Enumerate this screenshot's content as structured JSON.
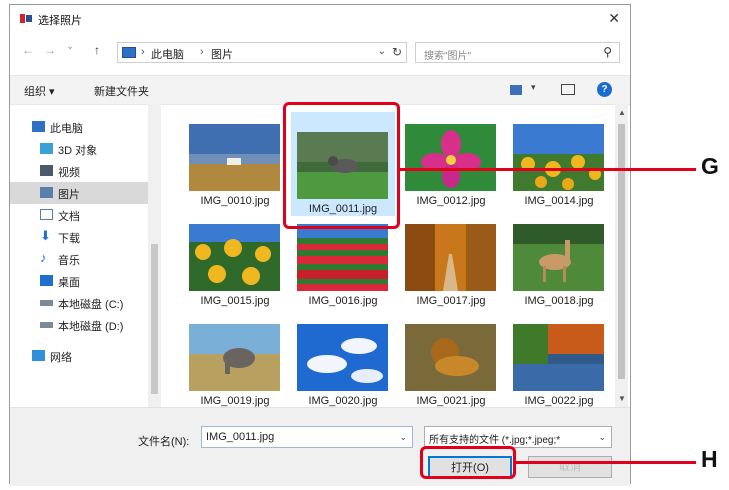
{
  "dialog": {
    "title": "选择照片",
    "close_glyph": "✕"
  },
  "address": {
    "back_glyph": "←",
    "forward_glyph": "→",
    "recent_glyph": "⌄",
    "up_glyph": "↑",
    "segments": [
      "此电脑",
      "图片"
    ],
    "separator": "›",
    "dropdown_glyph": "⌄",
    "refresh_glyph": "↻"
  },
  "search": {
    "placeholder": "搜索\"图片\"",
    "icon_glyph": "⚲"
  },
  "toolbar": {
    "organize_label": "组织 ▾",
    "new_folder_label": "新建文件夹",
    "view_dropdown_glyph": "▾",
    "help_label": "?"
  },
  "sidebar": {
    "items": [
      {
        "label": "此电脑",
        "icon": "computer-icon"
      },
      {
        "label": "3D 对象",
        "icon": "3d-objects-icon"
      },
      {
        "label": "视频",
        "icon": "video-icon"
      },
      {
        "label": "图片",
        "icon": "pictures-icon"
      },
      {
        "label": "文档",
        "icon": "documents-icon"
      },
      {
        "label": "下载",
        "icon": "download-icon"
      },
      {
        "label": "音乐",
        "icon": "music-icon"
      },
      {
        "label": "桌面",
        "icon": "desktop-icon"
      },
      {
        "label": "本地磁盘 (C:)",
        "icon": "drive-icon"
      },
      {
        "label": "本地磁盘 (D:)",
        "icon": "drive-icon"
      },
      {
        "label": "网络",
        "icon": "network-icon"
      }
    ],
    "selected": "图片"
  },
  "files": [
    {
      "name": "IMG_0010.jpg",
      "scene": "horse"
    },
    {
      "name": "IMG_0011.jpg",
      "scene": "cat",
      "selected": true
    },
    {
      "name": "IMG_0012.jpg",
      "scene": "flower"
    },
    {
      "name": "IMG_0014.jpg",
      "scene": "sunflowers"
    },
    {
      "name": "IMG_0015.jpg",
      "scene": "sunflowers"
    },
    {
      "name": "IMG_0016.jpg",
      "scene": "tulips"
    },
    {
      "name": "IMG_0017.jpg",
      "scene": "autumn-road"
    },
    {
      "name": "IMG_0018.jpg",
      "scene": "deer"
    },
    {
      "name": "IMG_0019.jpg",
      "scene": "elephant"
    },
    {
      "name": "IMG_0020.jpg",
      "scene": "clouds"
    },
    {
      "name": "IMG_0021.jpg",
      "scene": "lion"
    },
    {
      "name": "IMG_0022.jpg",
      "scene": "lake"
    }
  ],
  "footer": {
    "filename_label": "文件名(N):",
    "filename_value": "IMG_0011.jpg",
    "filter_value": "所有支持的文件 (*.jpg;*.jpeg;*",
    "dropdown_glyph": "⌄",
    "open_label": "打开(O)",
    "cancel_label": "取消"
  },
  "callouts": {
    "g_label": "G",
    "h_label": "H",
    "color": "#e1001a"
  },
  "scroll_glyphs": {
    "up": "▲",
    "down": "▼"
  }
}
